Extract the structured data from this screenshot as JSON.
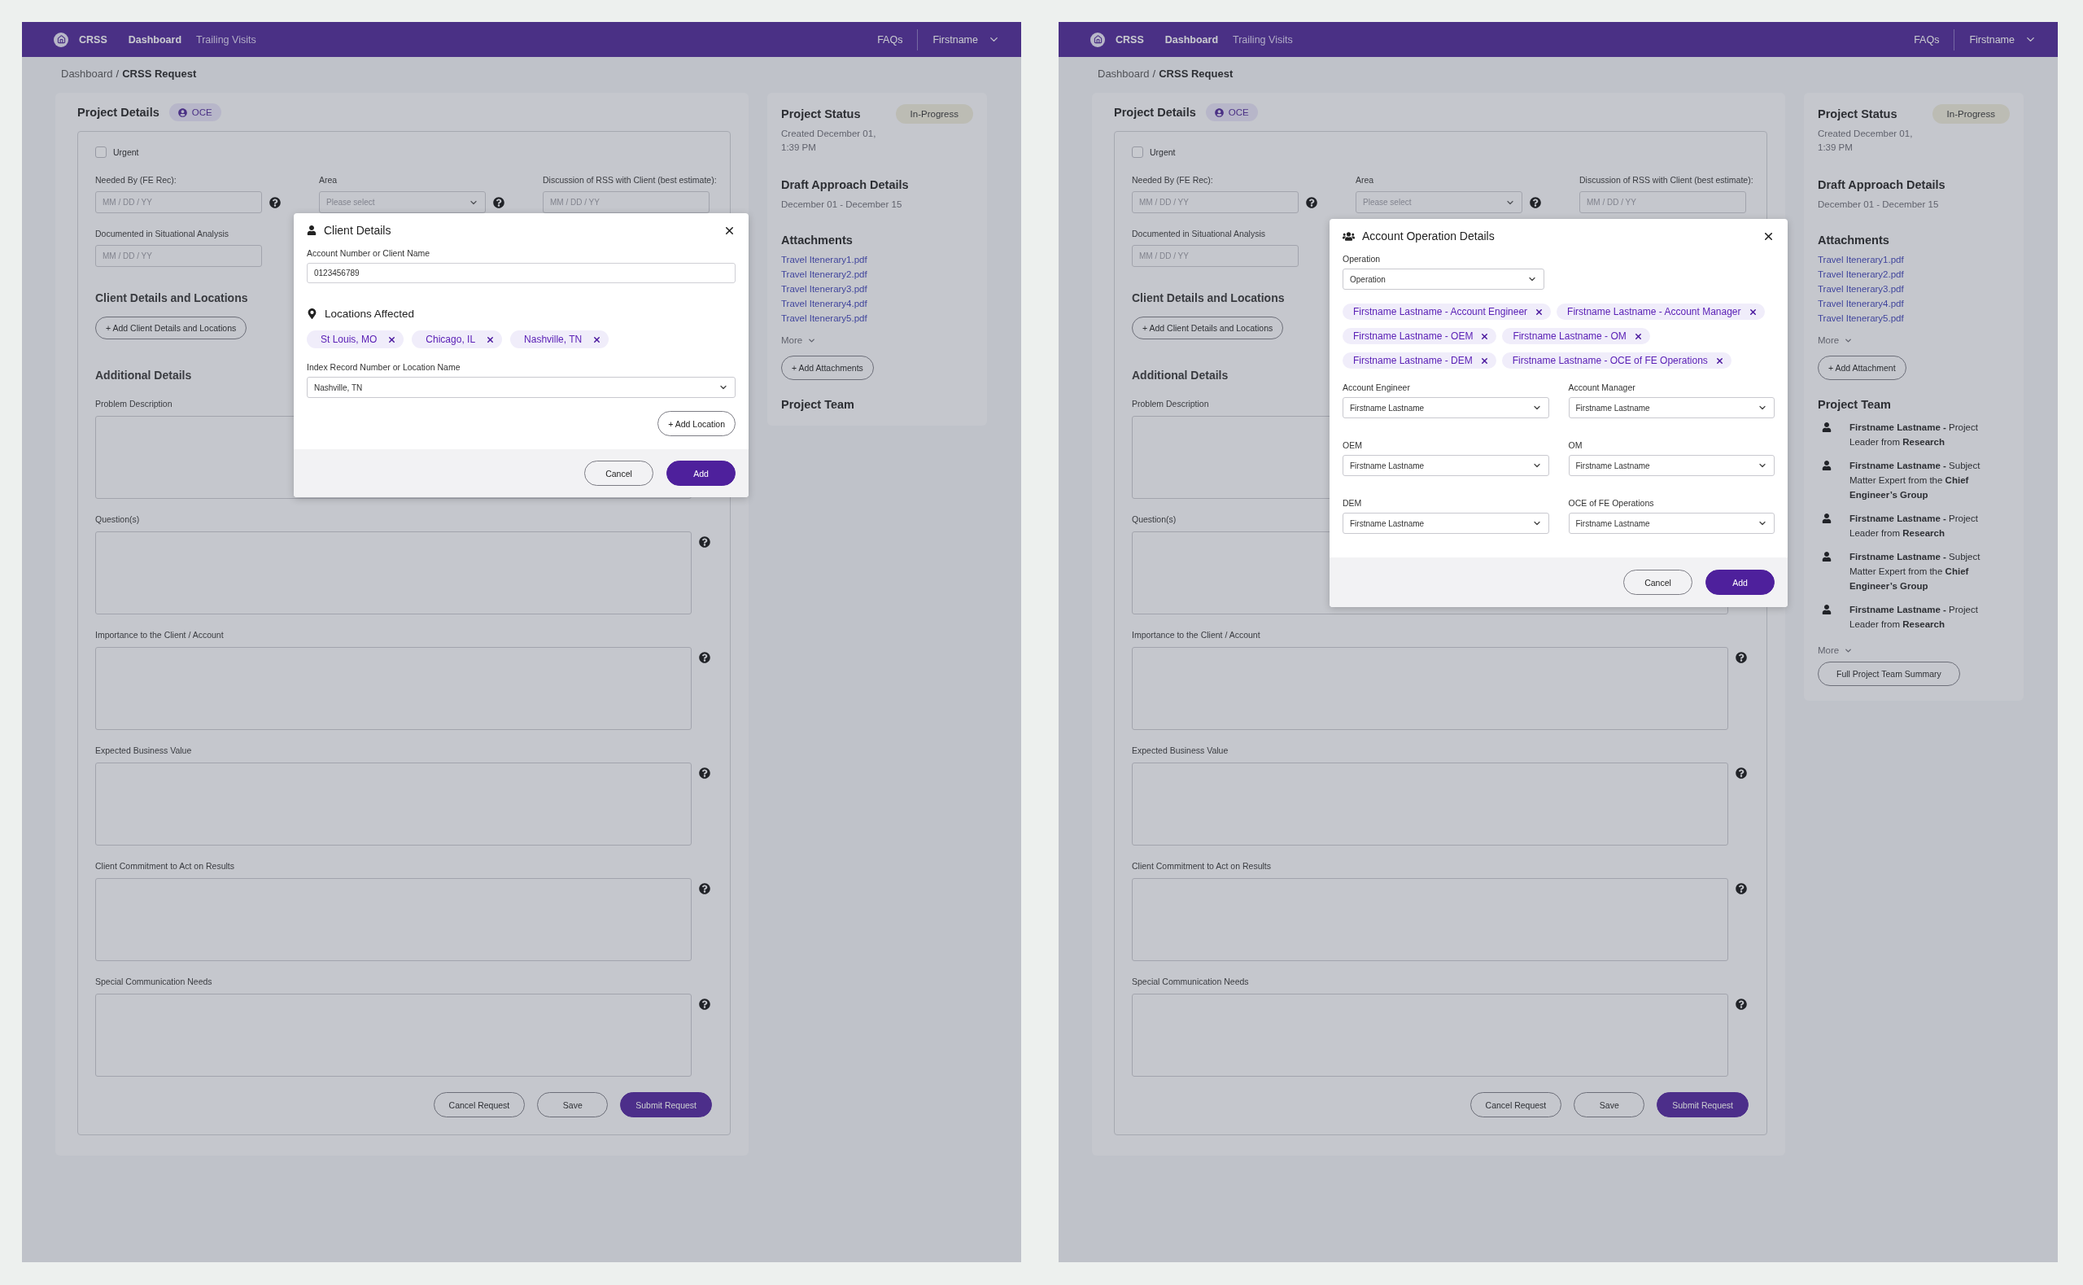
{
  "screens": [
    {
      "header": {
        "brand": "CRSS",
        "nav": [
          {
            "label": "Dashboard",
            "selected": true
          },
          {
            "label": "Trailing Visits",
            "selected": false
          }
        ],
        "faqs": "FAQs",
        "user": "Firstname"
      },
      "breadcrumb": {
        "link": "Dashboard",
        "separator": "/",
        "current": "CRSS Request"
      },
      "project": {
        "title": "Project Details",
        "badge": "OCE",
        "urgent": {
          "label": "Urgent",
          "checked": false
        },
        "top_fields": [
          {
            "kind": "date",
            "label": "Needed By (FE Rec):",
            "placeholder": "MM / DD / YY",
            "help_icon": true
          },
          {
            "kind": "select",
            "label": "Area",
            "placeholder": "Please select",
            "help_icon": true
          },
          {
            "kind": "date",
            "label": "Discussion of RSS with Client (best estimate):",
            "placeholder": "MM / DD / YY",
            "help_icon": false
          },
          {
            "kind": "date",
            "label": "Documented in Situational Analysis",
            "placeholder": "MM / DD / YY",
            "help_icon": false
          }
        ],
        "client_title": "Client Details and Locations",
        "client_button": "+ Add Client Details and Locations",
        "additional_title": "Additional Details",
        "text_fields": [
          {
            "label": "Problem Description",
            "help_icon": false
          },
          {
            "label": "Question(s)",
            "help_icon": true
          },
          {
            "label": "Importance to the Client / Account",
            "help_icon": true
          },
          {
            "label": "Expected Business Value",
            "help_icon": true
          },
          {
            "label": "Client Commitment to Act on Results",
            "help_icon": true
          },
          {
            "label": "Special Communication Needs",
            "help_icon": true
          }
        ],
        "actions": [
          {
            "label": "Cancel Request",
            "kind": "secondary"
          },
          {
            "label": "Save",
            "kind": "secondary"
          },
          {
            "label": "Submit Request",
            "kind": "primary"
          }
        ]
      },
      "sidebar": {
        "status_title": "Project Status",
        "status": "In-Progress",
        "created": "Created December 01, 1:39 PM",
        "draft_title": "Draft Approach Details",
        "draft_dates": "December 01 - December 15",
        "attachments_title": "Attachments",
        "files": [
          "Travel Itenerary1.pdf",
          "Travel Itenerary2.pdf",
          "Travel Itenerary3.pdf",
          "Travel Itenerary4.pdf",
          "Travel Itenerary5.pdf"
        ],
        "files_more": "More",
        "attach_button": "+ Add Attachments",
        "team_title": "Project Team"
      },
      "modal": {
        "kind": "client",
        "title": "Client Details",
        "account_label": "Account Number or Client Name",
        "account_value": "0123456789",
        "locations_title": "Locations Affected",
        "chips": [
          "St Louis, MO",
          "Chicago, IL",
          "Nashville, TN"
        ],
        "location_label": "Index Record Number or Location Name",
        "location_value": "Nashville, TN",
        "add_button": "+ Add Location",
        "buttons": [
          {
            "label": "Cancel",
            "kind": "secondary"
          },
          {
            "label": "Add",
            "kind": "primary"
          }
        ]
      }
    },
    {
      "header": {
        "brand": "CRSS",
        "nav": [
          {
            "label": "Dashboard",
            "selected": true
          },
          {
            "label": "Trailing Visits",
            "selected": false
          }
        ],
        "faqs": "FAQs",
        "user": "Firstname"
      },
      "breadcrumb": {
        "link": "Dashboard",
        "separator": "/",
        "current": "CRSS Request"
      },
      "project": {
        "title": "Project Details",
        "badge": "OCE",
        "urgent": {
          "label": "Urgent",
          "checked": false
        },
        "top_fields": [
          {
            "kind": "date",
            "label": "Needed By (FE Rec):",
            "placeholder": "MM / DD / YY",
            "help_icon": true
          },
          {
            "kind": "select",
            "label": "Area",
            "placeholder": "Please select",
            "help_icon": true
          },
          {
            "kind": "date",
            "label": "Discussion of RSS with Client (best estimate):",
            "placeholder": "MM / DD / YY",
            "help_icon": false
          },
          {
            "kind": "date",
            "label": "Documented in Situational Analysis",
            "placeholder": "MM / DD / YY",
            "help_icon": false
          }
        ],
        "client_title": "Client Details and Locations",
        "client_button": "+ Add Client Details and Locations",
        "additional_title": "Additional Details",
        "text_fields": [
          {
            "label": "Problem Description",
            "help_icon": false
          },
          {
            "label": "Question(s)",
            "help_icon": false
          },
          {
            "label": "Importance to the Client / Account",
            "help_icon": true
          },
          {
            "label": "Expected Business Value",
            "help_icon": true
          },
          {
            "label": "Client Commitment to Act on Results",
            "help_icon": true
          },
          {
            "label": "Special Communication Needs",
            "help_icon": true
          }
        ],
        "actions": [
          {
            "label": "Cancel Request",
            "kind": "secondary"
          },
          {
            "label": "Save",
            "kind": "secondary"
          },
          {
            "label": "Submit Request",
            "kind": "primary"
          }
        ]
      },
      "sidebar": {
        "status_title": "Project Status",
        "status": "In-Progress",
        "created": "Created December 01, 1:39 PM",
        "draft_title": "Draft Approach Details",
        "draft_dates": "December 01 - December 15",
        "attachments_title": "Attachments",
        "files": [
          "Travel Itenerary1.pdf",
          "Travel Itenerary2.pdf",
          "Travel Itenerary3.pdf",
          "Travel Itenerary4.pdf",
          "Travel Itenerary5.pdf"
        ],
        "files_more": "More",
        "attach_button": "+ Add Attachment",
        "team_title": "Project Team",
        "members": [
          "**Firstname Lastname -** Project Leader from **Research**",
          "**Firstname Lastname -** Subject Matter Expert from the **Chief Engineer’s Group**",
          "**Firstname Lastname -** Project Leader from **Research**",
          "**Firstname Lastname -** Subject Matter Expert from the **Chief Engineer’s Group**",
          "**Firstname Lastname -** Project Leader from **Research**"
        ],
        "team_more": "More",
        "team_button": "Full Project Team Summary"
      },
      "modal": {
        "kind": "operation",
        "title": "Account Operation Details",
        "operation_label": "Operation",
        "operation_value": "Operation",
        "chips": [
          "Firstname Lastname - Account Engineer",
          "Firstname Lastname - Account Manager",
          "Firstname Lastname - OEM",
          "Firstname Lastname - OM",
          "Firstname Lastname - DEM",
          "Firstname Lastname - OCE of FE Operations"
        ],
        "selects": [
          {
            "label": "Account Engineer",
            "value": "Firstname Lastname"
          },
          {
            "label": "Account Manager",
            "value": "Firstname Lastname"
          },
          {
            "label": "OEM",
            "value": "Firstname Lastname"
          },
          {
            "label": "OM",
            "value": "Firstname Lastname"
          },
          {
            "label": "DEM",
            "value": "Firstname Lastname"
          },
          {
            "label": "OCE of FE Operations",
            "value": "Firstname Lastname"
          }
        ],
        "buttons": [
          {
            "label": "Cancel",
            "kind": "secondary"
          },
          {
            "label": "Add",
            "kind": "primary"
          }
        ]
      }
    }
  ]
}
